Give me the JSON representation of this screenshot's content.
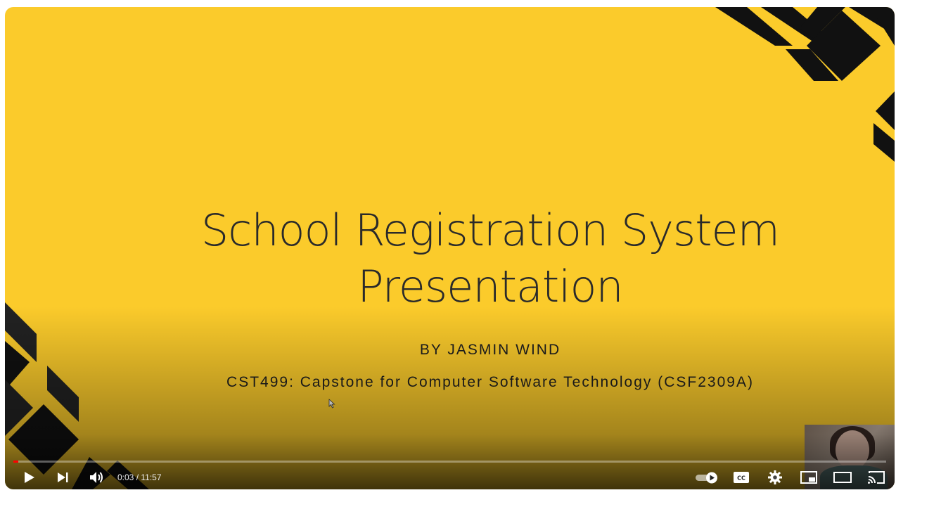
{
  "slide": {
    "title_line1": "School Registration System",
    "title_line2": "Presentation",
    "author": "BY JASMIN WIND",
    "course": "CST499: Capstone for Computer Software Technology (CSF2309A)",
    "background_color": "#FBCB2B"
  },
  "player": {
    "current_time": "0:03",
    "separator": " / ",
    "duration": "11:57",
    "progress_fraction": 0.004,
    "progress_color": "#ff0000",
    "icons": {
      "play": "play-icon",
      "next": "next-icon",
      "volume": "volume-icon",
      "autoplay": "autoplay-toggle-icon",
      "captions": "captions-icon",
      "settings": "settings-gear-icon",
      "miniplayer": "miniplayer-icon",
      "theater": "theater-mode-icon",
      "cast": "cast-icon"
    }
  }
}
